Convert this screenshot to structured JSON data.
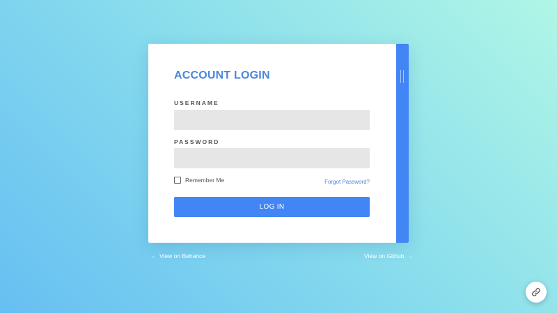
{
  "login": {
    "title": "ACCOUNT LOGIN",
    "username_label": "USERNAME",
    "username_value": "",
    "password_label": "PASSWORD",
    "password_value": "",
    "remember_label": "Remember Me",
    "remember_checked": false,
    "forgot_label": "Forgot Password?",
    "submit_label": "LOG IN"
  },
  "footer": {
    "behance_label": "View on Behance",
    "github_label": "View on Github"
  },
  "icons": {
    "left_arrow": "arrow-left-icon",
    "right_arrow": "arrow-right-icon",
    "fab": "link-icon"
  },
  "colors": {
    "accent": "#4285f4",
    "title": "#4a86dd",
    "field_bg": "#e6e6e6"
  }
}
